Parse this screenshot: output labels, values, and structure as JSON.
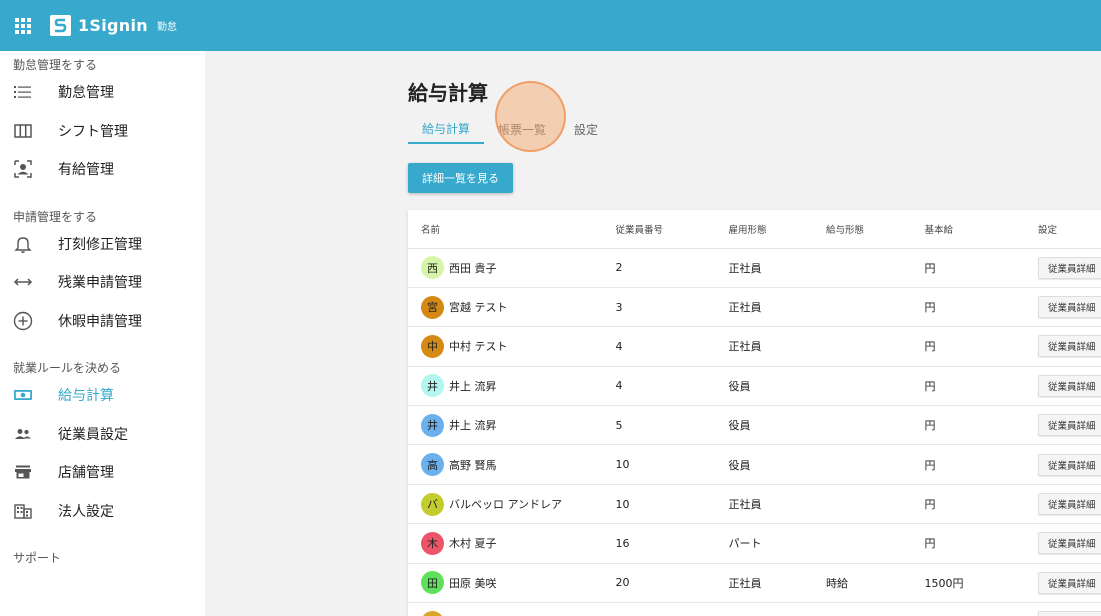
{
  "header": {
    "app_name": "1Signin",
    "sub_label": "勤怠"
  },
  "sidebar": {
    "sections": [
      {
        "title": "勤怠管理をする",
        "items": [
          {
            "label": "勤怠管理",
            "icon": "list-icon"
          },
          {
            "label": "シフト管理",
            "icon": "columns-icon"
          },
          {
            "label": "有給管理",
            "icon": "person-badge-icon"
          }
        ]
      },
      {
        "title": "申請管理をする",
        "items": [
          {
            "label": "打刻修正管理",
            "icon": "bell-icon"
          },
          {
            "label": "残業申請管理",
            "icon": "arrows-horizontal-icon"
          },
          {
            "label": "休暇申請管理",
            "icon": "plus-circle-icon"
          }
        ]
      },
      {
        "title": "就業ルールを決める",
        "items": [
          {
            "label": "給与計算",
            "icon": "money-icon",
            "active": true
          },
          {
            "label": "従業員設定",
            "icon": "people-icon"
          },
          {
            "label": "店舗管理",
            "icon": "store-icon"
          },
          {
            "label": "法人設定",
            "icon": "building-icon"
          }
        ]
      },
      {
        "title": "サポート",
        "items": []
      }
    ]
  },
  "main": {
    "title": "給与計算",
    "tabs": [
      {
        "label": "給与計算",
        "active": true
      },
      {
        "label": "帳票一覧",
        "active": false
      },
      {
        "label": "設定",
        "active": false
      }
    ],
    "detail_button": "詳細一覧を見る",
    "table": {
      "headers": [
        "名前",
        "従業員番号",
        "雇用形態",
        "給与形態",
        "基本給",
        "設定"
      ],
      "row_button": "従業員詳細",
      "rows": [
        {
          "initial": "西",
          "name": "西田 貴子",
          "number": "2",
          "employment": "正社員",
          "pay_type": "",
          "base": "円",
          "color": "#d6f5a8"
        },
        {
          "initial": "宮",
          "name": "宮越 テスト",
          "number": "3",
          "employment": "正社員",
          "pay_type": "",
          "base": "円",
          "color": "#d48a14"
        },
        {
          "initial": "中",
          "name": "中村 テスト",
          "number": "4",
          "employment": "正社員",
          "pay_type": "",
          "base": "円",
          "color": "#d48a14"
        },
        {
          "initial": "井",
          "name": "井上 流昇",
          "number": "4",
          "employment": "役員",
          "pay_type": "",
          "base": "円",
          "color": "#b3f5ef"
        },
        {
          "initial": "井",
          "name": "井上 流昇",
          "number": "5",
          "employment": "役員",
          "pay_type": "",
          "base": "円",
          "color": "#6ab0ec"
        },
        {
          "initial": "高",
          "name": "高野 賢馬",
          "number": "10",
          "employment": "役員",
          "pay_type": "",
          "base": "円",
          "color": "#6ab0ec"
        },
        {
          "initial": "バ",
          "name": "バルベッロ アンドレア",
          "number": "10",
          "employment": "正社員",
          "pay_type": "",
          "base": "円",
          "color": "#c2cc2a"
        },
        {
          "initial": "木",
          "name": "木村 夏子",
          "number": "16",
          "employment": "パート",
          "pay_type": "",
          "base": "円",
          "color": "#ec5468"
        },
        {
          "initial": "田",
          "name": "田原 美咲",
          "number": "20",
          "employment": "正社員",
          "pay_type": "時給",
          "base": "1500円",
          "color": "#5fe05a"
        },
        {
          "initial": "",
          "name": "",
          "number": "",
          "employment": "",
          "pay_type": "",
          "base": "",
          "color": "#d9a526"
        }
      ]
    }
  }
}
